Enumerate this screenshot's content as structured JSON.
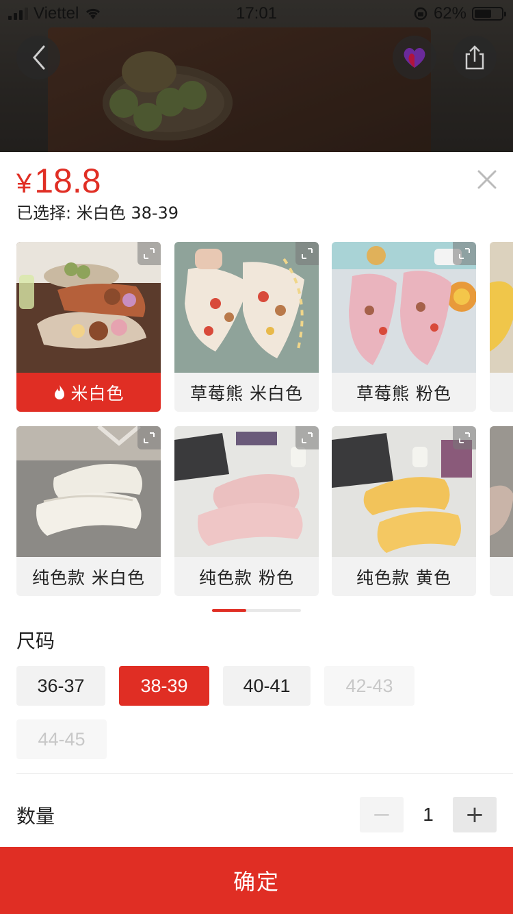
{
  "status_bar": {
    "carrier": "Viettel",
    "time": "17:01",
    "battery": "62%",
    "battery_level": 0.62
  },
  "top_actions": {
    "back_icon": "chevron-left-icon",
    "favorite_icon": "heart-icon",
    "share_icon": "share-icon"
  },
  "product": {
    "currency": "¥",
    "price": "18.8",
    "selected_text": "已选择: 米白色 38-39"
  },
  "colors": {
    "accent": "#e02e24"
  },
  "variants": [
    {
      "label": "米白色",
      "active": true,
      "hot_icon": "flame-icon"
    },
    {
      "label": "草莓熊 米白色",
      "active": false
    },
    {
      "label": "草莓熊 粉色",
      "active": false
    },
    {
      "label": "纯色款 米白色",
      "active": false
    },
    {
      "label": "纯色款 粉色",
      "active": false
    },
    {
      "label": "纯色款 黄色",
      "active": false
    }
  ],
  "size": {
    "title": "尺码",
    "options": [
      {
        "label": "36-37",
        "state": "normal"
      },
      {
        "label": "38-39",
        "state": "selected"
      },
      {
        "label": "40-41",
        "state": "normal"
      },
      {
        "label": "42-43",
        "state": "disabled"
      },
      {
        "label": "44-45",
        "state": "disabled"
      }
    ]
  },
  "quantity": {
    "title": "数量",
    "value": "1",
    "minus": "−",
    "plus": "+"
  },
  "confirm_label": "确定"
}
